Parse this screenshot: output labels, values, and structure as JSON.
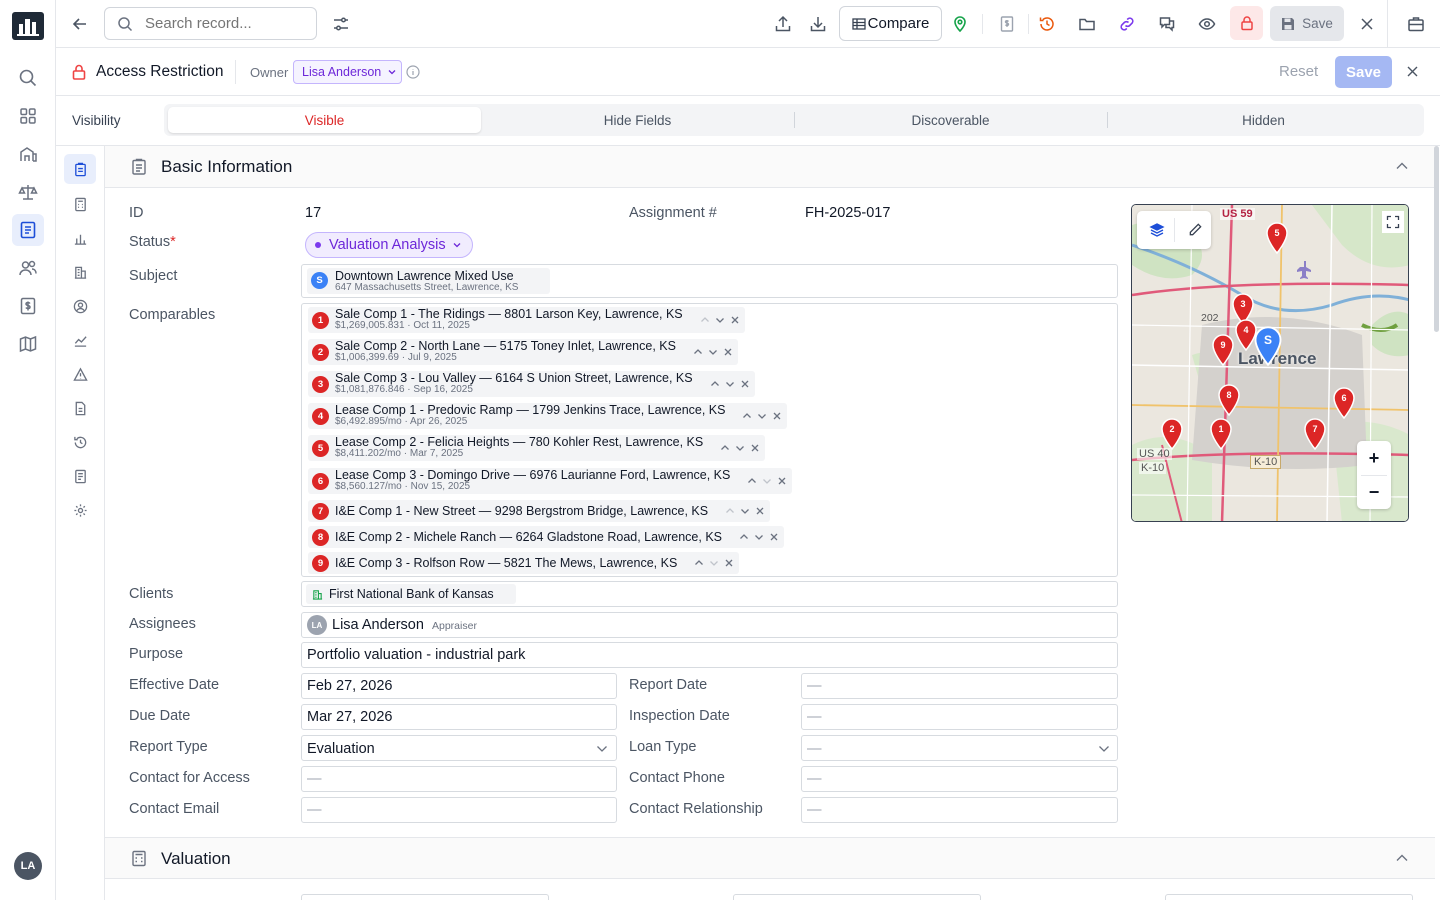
{
  "rail": {
    "user_initials": "LA"
  },
  "topbar": {
    "search_placeholder": "Search record...",
    "compare_label": "Compare",
    "save_label": "Save"
  },
  "access": {
    "title": "Access Restriction",
    "owner_label": "Owner",
    "owner_name": "Lisa Anderson",
    "reset_label": "Reset",
    "save_label": "Save"
  },
  "visibility": {
    "label": "Visibility",
    "options": [
      "Visible",
      "Hide Fields",
      "Discoverable",
      "Hidden"
    ],
    "selected": "Visible"
  },
  "basic": {
    "title": "Basic Information",
    "id_label": "ID",
    "id_value": "17",
    "assignment_label": "Assignment #",
    "assignment_value": "FH-2025-017",
    "status_label": "Status",
    "status_required": "*",
    "status_value": "Valuation Analysis",
    "subject_label": "Subject",
    "subject_badge": "S",
    "subject_name": "Downtown Lawrence Mixed Use",
    "subject_address": "647 Massachusetts Street, Lawrence, KS",
    "comparables_label": "Comparables",
    "comparables": [
      {
        "num": "1",
        "title": "Sale Comp 1 - The Ridings — 8801 Larson Key, Lawrence, KS",
        "detail": "$1,269,005.831 · Oct 11, 2025"
      },
      {
        "num": "2",
        "title": "Sale Comp 2 - North Lane — 5175 Toney Inlet, Lawrence, KS",
        "detail": "$1,006,399.69 · Jul 9, 2025"
      },
      {
        "num": "3",
        "title": "Sale Comp 3 - Lou Valley — 6164 S Union Street, Lawrence, KS",
        "detail": "$1,081,876.846 · Sep 16, 2025"
      },
      {
        "num": "4",
        "title": "Lease Comp 1 - Predovic Ramp — 1799 Jenkins Trace, Lawrence, KS",
        "detail": "$6,492.895/mo · Apr 26, 2025"
      },
      {
        "num": "5",
        "title": "Lease Comp 2 - Felicia Heights — 780 Kohler Rest, Lawrence, KS",
        "detail": "$8,411.202/mo · Mar 7, 2025"
      },
      {
        "num": "6",
        "title": "Lease Comp 3 - Domingo Drive — 6976 Laurianne Ford, Lawrence, KS",
        "detail": "$8,560.127/mo · Nov 15, 2025"
      },
      {
        "num": "7",
        "title": "I&E Comp 1 - New Street — 9298 Bergstrom Bridge, Lawrence, KS",
        "detail": ""
      },
      {
        "num": "8",
        "title": "I&E Comp 2 - Michele Ranch — 6264 Gladstone Road, Lawrence, KS",
        "detail": ""
      },
      {
        "num": "9",
        "title": "I&E Comp 3 - Rolfson Row — 5821 The Mews, Lawrence, KS",
        "detail": ""
      }
    ],
    "clients_label": "Clients",
    "client_name": "First National Bank of Kansas",
    "assignees_label": "Assignees",
    "assignee_initials": "LA",
    "assignee_name": "Lisa Anderson",
    "assignee_role": "Appraiser",
    "purpose_label": "Purpose",
    "purpose_value": "Portfolio valuation - industrial park",
    "effective_date_label": "Effective Date",
    "effective_date_value": "Feb 27, 2026",
    "report_date_label": "Report Date",
    "report_date_value": "—",
    "due_date_label": "Due Date",
    "due_date_value": "Mar 27, 2026",
    "inspection_date_label": "Inspection Date",
    "inspection_date_value": "—",
    "report_type_label": "Report Type",
    "report_type_value": "Evaluation",
    "loan_type_label": "Loan Type",
    "loan_type_value": "—",
    "contact_access_label": "Contact for Access",
    "contact_access_value": "—",
    "contact_phone_label": "Contact Phone",
    "contact_phone_value": "—",
    "contact_email_label": "Contact Email",
    "contact_email_value": "—",
    "contact_relationship_label": "Contact Relationship",
    "contact_relationship_value": "—"
  },
  "map": {
    "city_label": "Lawrence",
    "road_labels": [
      "US 59",
      "202",
      "US 40",
      "K-10",
      "K-10"
    ],
    "zoom_in": "+",
    "zoom_out": "−",
    "subject_pin": "S",
    "pins": [
      "1",
      "2",
      "3",
      "4",
      "5",
      "6",
      "7",
      "8",
      "9"
    ]
  },
  "valuation": {
    "title": "Valuation"
  },
  "colors": {
    "accent": "#2563eb",
    "status_purple": "#7c3aed",
    "pin_red": "#dc2626",
    "save_disabled": "#a5b8f3"
  }
}
